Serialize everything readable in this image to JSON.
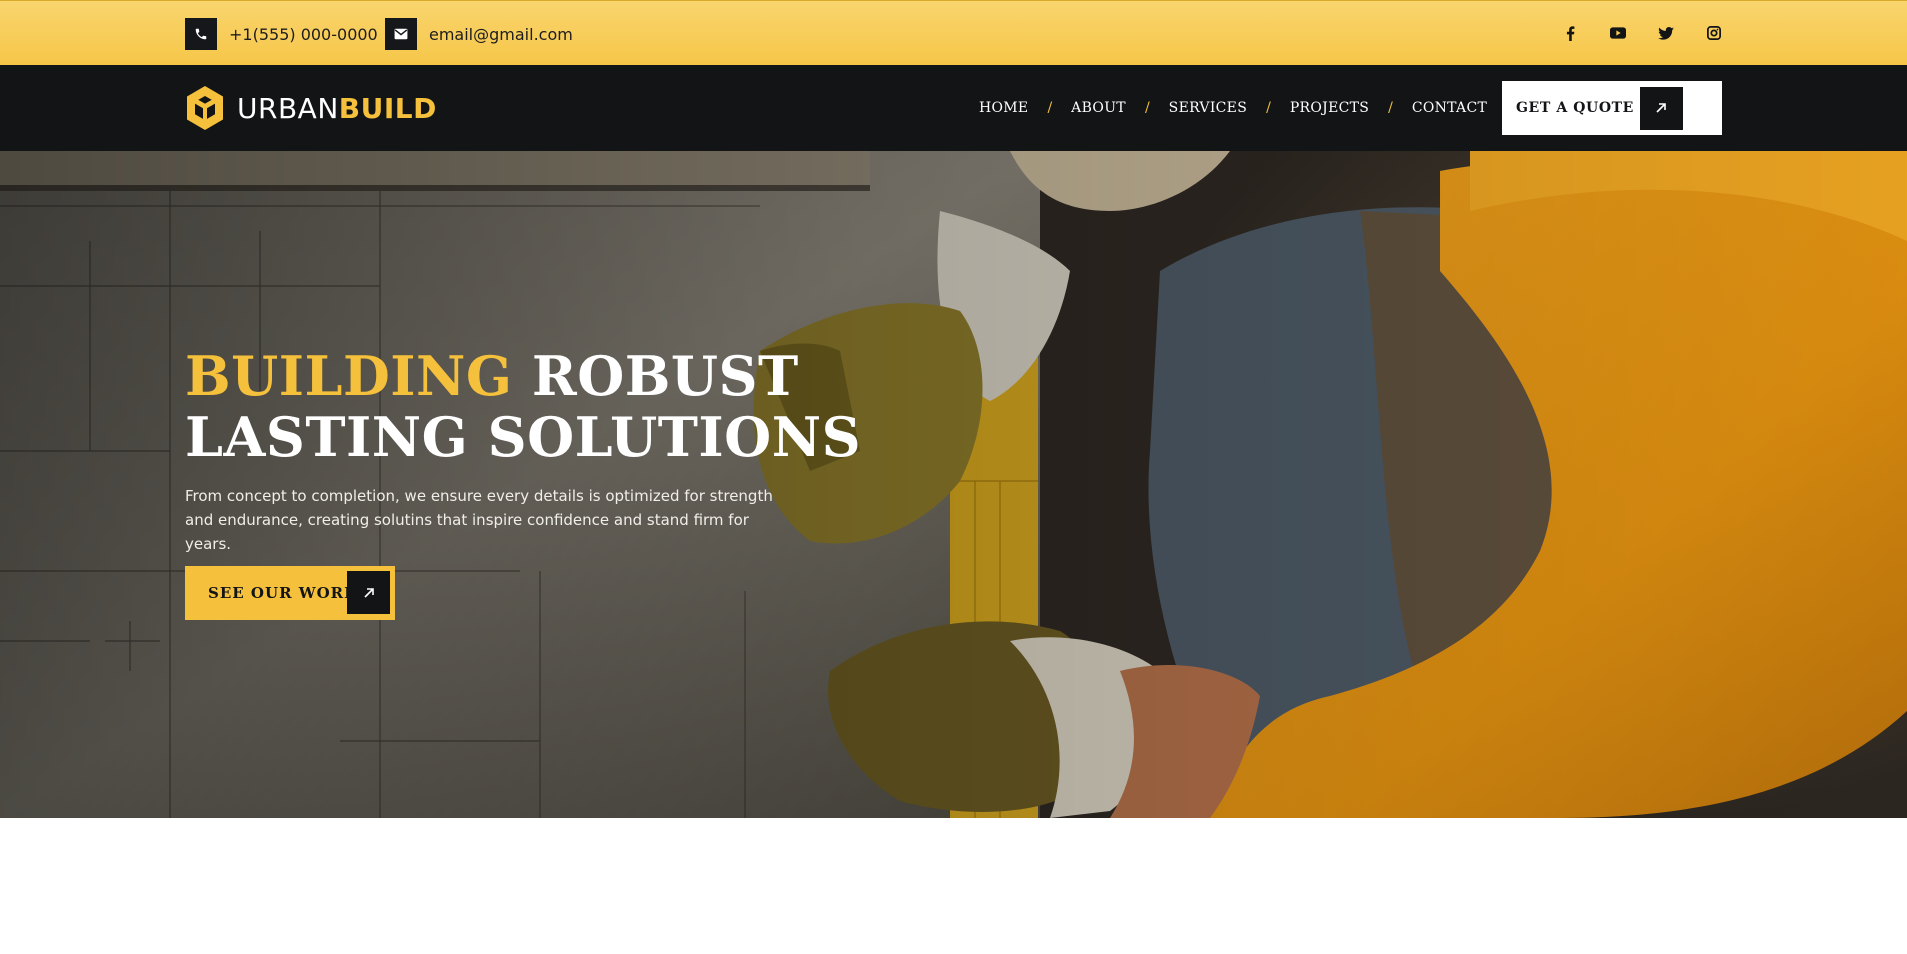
{
  "topbar": {
    "phone": "+1(555) 000-0000",
    "email": "email@gmail.com",
    "socials": [
      "facebook-icon",
      "youtube-icon",
      "twitter-icon",
      "instagram-icon"
    ]
  },
  "brand": {
    "name_part1": "URBAN",
    "name_part2": "BUILD"
  },
  "nav": {
    "items": [
      {
        "label": "HOME"
      },
      {
        "label": "ABOUT"
      },
      {
        "label": "SERVICES"
      },
      {
        "label": "PROJECTS"
      },
      {
        "label": "CONTACT"
      }
    ],
    "separator": "/",
    "cta_label": "GET A QUOTE"
  },
  "hero": {
    "title_highlight": "BUILDING",
    "title_rest_line1": "ROBUST",
    "title_line2": "LASTING SOLUTIONS",
    "description": "From concept to completion, we ensure every details is optimized for strength and endurance, creating solutins that inspire confidence and stand firm for years.",
    "cta_label": "SEE OUR WORK"
  },
  "colors": {
    "accent": "#f5c03b",
    "dark": "#131416",
    "topbar": "#f7ca52"
  }
}
